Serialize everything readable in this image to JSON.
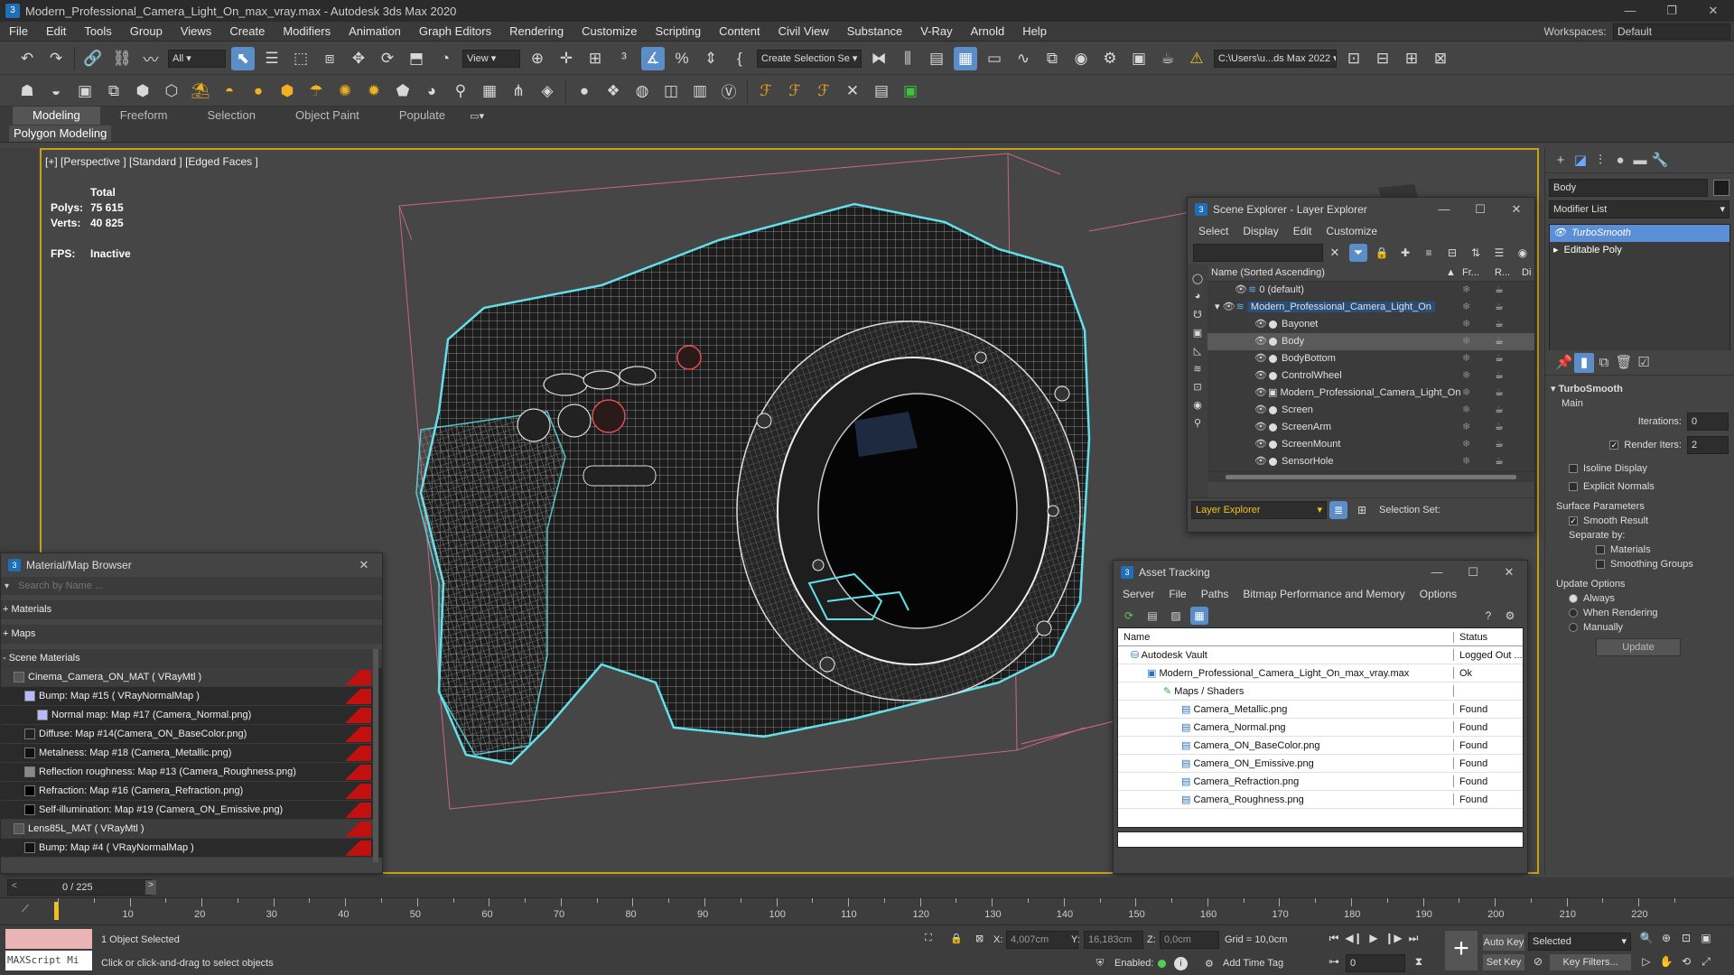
{
  "app": {
    "title": "Modern_Professional_Camera_Light_On_max_vray.max - Autodesk 3ds Max 2020"
  },
  "menu": [
    "File",
    "Edit",
    "Tools",
    "Group",
    "Views",
    "Create",
    "Modifiers",
    "Animation",
    "Graph Editors",
    "Rendering",
    "Customize",
    "Scripting",
    "Content",
    "Civil View",
    "Substance",
    "V-Ray",
    "Arnold",
    "Help"
  ],
  "workspace": {
    "label": "Workspaces:",
    "value": "Default"
  },
  "toolbar": {
    "filter_value": "All",
    "view_value": "View",
    "selection_set_placeholder": "Create Selection Se",
    "path_value": "C:\\Users\\u...ds Max 2022"
  },
  "ribbon": {
    "tabs": [
      "Modeling",
      "Freeform",
      "Selection",
      "Object Paint",
      "Populate"
    ],
    "sub": "Polygon Modeling"
  },
  "viewport": {
    "label": "[+] [Perspective ] [Standard ] [Edged Faces ]",
    "stats_header": "Total",
    "polys_label": "Polys:",
    "polys_value": "75 615",
    "verts_label": "Verts:",
    "verts_value": "40 825",
    "fps_label": "FPS:",
    "fps_value": "Inactive"
  },
  "scene_explorer": {
    "title": "Scene Explorer - Layer Explorer",
    "menu": [
      "Select",
      "Display",
      "Edit",
      "Customize"
    ],
    "columns": {
      "name": "Name (Sorted Ascending)",
      "fr": "Fr...",
      "r": "R...",
      "d": "Di"
    },
    "rows": [
      {
        "label": "0 (default)",
        "level": 0
      },
      {
        "label": "Modern_Professional_Camera_Light_On",
        "level": 0
      },
      {
        "label": "Bayonet",
        "level": 1
      },
      {
        "label": "Body",
        "level": 1
      },
      {
        "label": "BodyBottom",
        "level": 1
      },
      {
        "label": "ControlWheel",
        "level": 1
      },
      {
        "label": "Modern_Professional_Camera_Light_On",
        "level": 1
      },
      {
        "label": "Screen",
        "level": 1
      },
      {
        "label": "ScreenArm",
        "level": 1
      },
      {
        "label": "ScreenMount",
        "level": 1
      },
      {
        "label": "SensorHole",
        "level": 1
      }
    ],
    "footer_dropdown": "Layer Explorer",
    "selection_set_label": "Selection Set:"
  },
  "asset_tracking": {
    "title": "Asset Tracking",
    "menu": [
      "Server",
      "File",
      "Paths",
      "Bitmap Performance and Memory",
      "Options"
    ],
    "col_name": "Name",
    "col_status": "Status",
    "rows": [
      {
        "name": "Autodesk Vault",
        "status": "Logged Out ..."
      },
      {
        "name": "Modern_Professional_Camera_Light_On_max_vray.max",
        "status": "Ok"
      },
      {
        "name": "Maps / Shaders",
        "status": ""
      },
      {
        "name": "Camera_Metallic.png",
        "status": "Found"
      },
      {
        "name": "Camera_Normal.png",
        "status": "Found"
      },
      {
        "name": "Camera_ON_BaseColor.png",
        "status": "Found"
      },
      {
        "name": "Camera_ON_Emissive.png",
        "status": "Found"
      },
      {
        "name": "Camera_Refraction.png",
        "status": "Found"
      },
      {
        "name": "Camera_Roughness.png",
        "status": "Found"
      }
    ]
  },
  "material_browser": {
    "title": "Material/Map Browser",
    "search_placeholder": "Search by Name ...",
    "sections": [
      "+ Materials",
      "+ Maps",
      "- Scene Materials"
    ],
    "rows": [
      "Cinema_Camera_ON_MAT ( VRayMtl )",
      "Bump: Map #15 ( VRayNormalMap )",
      "Normal map: Map #17 (Camera_Normal.png)",
      "Diffuse: Map #14(Camera_ON_BaseColor.png)",
      "Metalness: Map #18 (Camera_Metallic.png)",
      "Reflection roughness: Map #13 (Camera_Roughness.png)",
      "Refraction: Map #16 (Camera_Refraction.png)",
      "Self-illumination: Map #19 (Camera_ON_Emissive.png)",
      "Lens85L_MAT ( VRayMtl )",
      "Bump: Map #4 ( VRayNormalMap )"
    ]
  },
  "command_panel": {
    "object_name": "Body",
    "modifier_list": "Modifier List",
    "stack": [
      "TurboSmooth",
      "Editable Poly"
    ],
    "rollout_title": "TurboSmooth",
    "main_label": "Main",
    "iterations_label": "Iterations:",
    "iterations_value": "0",
    "render_iters_label": "Render Iters:",
    "render_iters_value": "2",
    "isoline": "Isoline Display",
    "explicit": "Explicit Normals",
    "surface_params": "Surface Parameters",
    "smooth_result": "Smooth Result",
    "separate_by": "Separate by:",
    "materials": "Materials",
    "smoothing_groups": "Smoothing Groups",
    "update_options": "Update Options",
    "always": "Always",
    "when_rendering": "When Rendering",
    "manually": "Manually",
    "update_btn": "Update"
  },
  "timeline": {
    "frame": "0 / 225",
    "ticks": [
      "10",
      "20",
      "30",
      "40",
      "50",
      "60",
      "70",
      "80",
      "90",
      "100",
      "110",
      "120",
      "130",
      "140",
      "150",
      "160",
      "170",
      "180",
      "190",
      "200",
      "210",
      "220"
    ]
  },
  "status": {
    "maxscript": "MAXScript Mi",
    "selected": "1 Object Selected",
    "hint": "Click or click-and-drag to select objects",
    "x_label": "X:",
    "x_value": "4,007cm",
    "y_label": "Y:",
    "y_value": "16,183cm",
    "z_label": "Z:",
    "z_value": "0,0cm",
    "grid": "Grid = 10,0cm",
    "enabled": "Enabled:",
    "add_time_tag": "Add Time Tag",
    "auto_key": "Auto Key",
    "set_key": "Set Key",
    "selected_drop": "Selected",
    "key_filters": "Key Filters...",
    "frame_field": "0"
  }
}
